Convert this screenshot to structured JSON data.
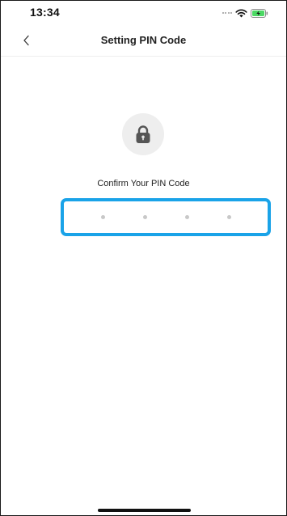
{
  "status_bar": {
    "time": "13:34",
    "icons": [
      "signal-dots",
      "wifi-icon",
      "battery-charging-icon"
    ]
  },
  "nav": {
    "title": "Setting PIN Code",
    "back_icon": "chevron-left-icon"
  },
  "lock": {
    "icon": "lock-icon"
  },
  "pin": {
    "prompt": "Confirm Your PIN Code",
    "length": 4,
    "entered": 0
  },
  "colors": {
    "focus_border": "#1aa3e8",
    "battery_fill": "#4cd964",
    "pin_dot": "#c8c8c8",
    "lock_badge_bg": "#eeeeee",
    "lock_body": "#555555"
  }
}
